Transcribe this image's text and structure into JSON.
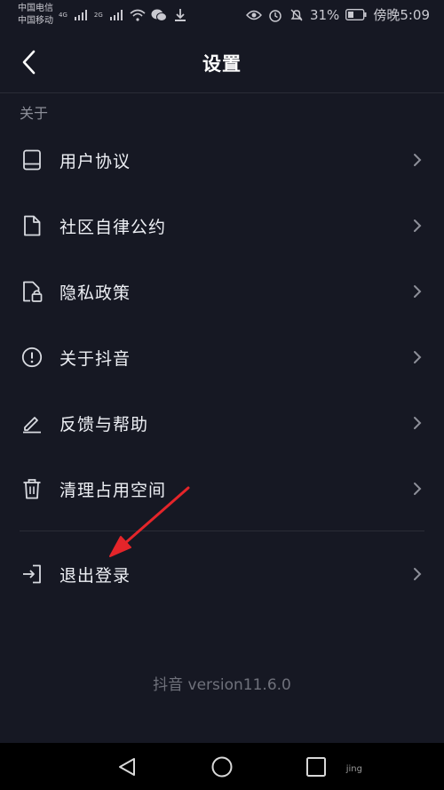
{
  "status_bar": {
    "carrier_1": "中国电信",
    "carrier_2": "中国移动",
    "net_1": "4G",
    "net_2": "2G",
    "battery": "31%",
    "time": "傍晚5:09"
  },
  "header": {
    "title": "设置"
  },
  "section": {
    "label": "关于"
  },
  "menu": [
    {
      "label": "用户协议",
      "icon": "book-icon"
    },
    {
      "label": "社区自律公约",
      "icon": "document-icon"
    },
    {
      "label": "隐私政策",
      "icon": "lock-document-icon"
    },
    {
      "label": "关于抖音",
      "icon": "info-circle-icon"
    },
    {
      "label": "反馈与帮助",
      "icon": "pen-icon"
    },
    {
      "label": "清理占用空间",
      "icon": "trash-icon"
    }
  ],
  "logout": {
    "label": "退出登录",
    "icon": "logout-icon"
  },
  "footer": {
    "version": "抖音 version11.6.0"
  },
  "watermark": "jing",
  "colors": {
    "background": "#161823",
    "annotation_arrow": "#e5252a"
  }
}
